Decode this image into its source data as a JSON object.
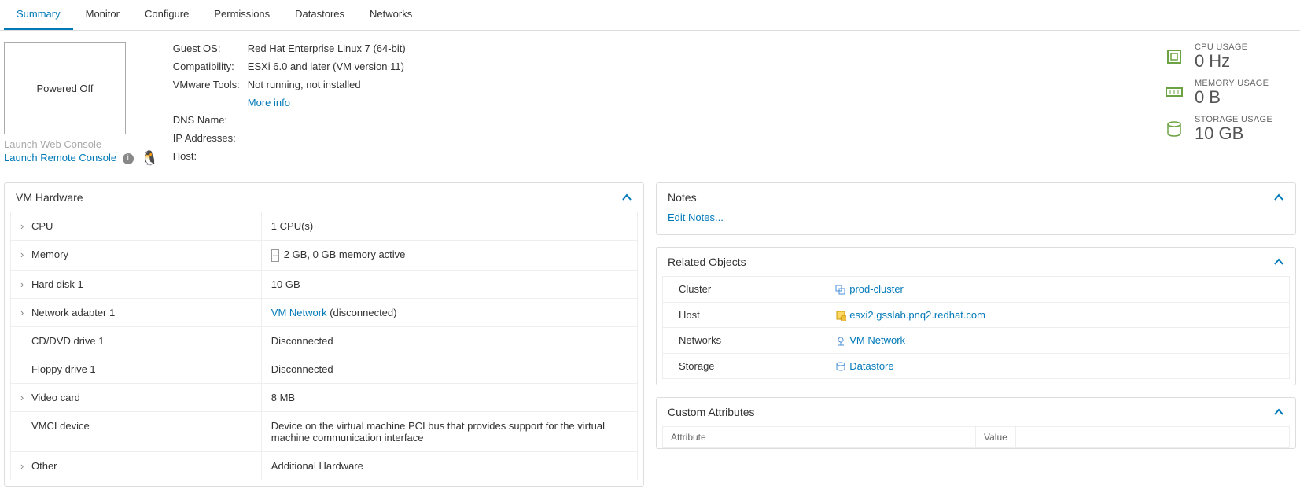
{
  "tabs": [
    "Summary",
    "Monitor",
    "Configure",
    "Permissions",
    "Datastores",
    "Networks"
  ],
  "vm": {
    "power_state": "Powered Off",
    "launch_web": "Launch Web Console",
    "launch_remote": "Launch Remote Console",
    "info": {
      "guest_os_label": "Guest OS:",
      "guest_os": "Red Hat Enterprise Linux 7 (64-bit)",
      "compat_label": "Compatibility:",
      "compat": "ESXi 6.0 and later (VM version 11)",
      "tools_label": "VMware Tools:",
      "tools": "Not running, not installed",
      "more_info": "More info",
      "dns_label": "DNS Name:",
      "dns": "",
      "ip_label": "IP Addresses:",
      "ip": "",
      "host_label": "Host:",
      "host": ""
    }
  },
  "usage": {
    "cpu_label": "CPU USAGE",
    "cpu_value": "0 Hz",
    "mem_label": "MEMORY USAGE",
    "mem_value": "0 B",
    "storage_label": "STORAGE USAGE",
    "storage_value": "10 GB"
  },
  "hw": {
    "title": "VM Hardware",
    "rows": {
      "cpu_l": "CPU",
      "cpu_v": "1 CPU(s)",
      "mem_l": "Memory",
      "mem_v": "2 GB, 0 GB memory active",
      "hd_l": "Hard disk 1",
      "hd_v": "10 GB",
      "net_l": "Network adapter 1",
      "net_link": "VM Network",
      "net_suffix": " (disconnected)",
      "cd_l": "CD/DVD drive 1",
      "cd_v": "Disconnected",
      "fd_l": "Floppy drive 1",
      "fd_v": "Disconnected",
      "vc_l": "Video card",
      "vc_v": "8 MB",
      "vmci_l": "VMCI device",
      "vmci_v": "Device on the virtual machine PCI bus that provides support for the virtual machine communication interface",
      "other_l": "Other",
      "other_v": "Additional Hardware"
    }
  },
  "notes": {
    "title": "Notes",
    "edit": "Edit Notes..."
  },
  "related": {
    "title": "Related Objects",
    "cluster_l": "Cluster",
    "cluster_v": "prod-cluster",
    "host_l": "Host",
    "host_v": "esxi2.gsslab.pnq2.redhat.com",
    "net_l": "Networks",
    "net_v": "VM Network",
    "storage_l": "Storage",
    "storage_v": "Datastore"
  },
  "ca": {
    "title": "Custom Attributes",
    "col1": "Attribute",
    "col2": "Value"
  }
}
